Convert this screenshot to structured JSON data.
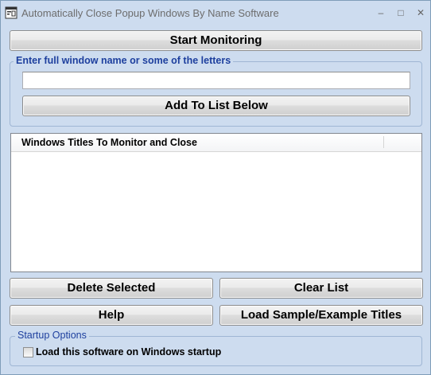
{
  "window": {
    "title": "Automatically Close Popup Windows By Name Software",
    "controls": {
      "minimize": "–",
      "maximize": "□",
      "close": "✕"
    }
  },
  "main": {
    "start_monitoring_label": "Start Monitoring",
    "entry_group": {
      "legend": "Enter full window name or some of the letters",
      "input_value": "",
      "add_button_label": "Add To List Below"
    },
    "list": {
      "column_header": "Windows Titles To Monitor and Close",
      "rows": []
    },
    "buttons": {
      "delete_selected": "Delete Selected",
      "clear_list": "Clear List",
      "help": "Help",
      "load_sample": "Load Sample/Example Titles"
    },
    "startup": {
      "legend": "Startup Options",
      "checkbox_label": "Load this software on Windows startup",
      "checked": false
    }
  },
  "colors": {
    "window_bg": "#cddcef",
    "group_legend": "#1d3f9e",
    "title_text": "#6d6d6d"
  }
}
